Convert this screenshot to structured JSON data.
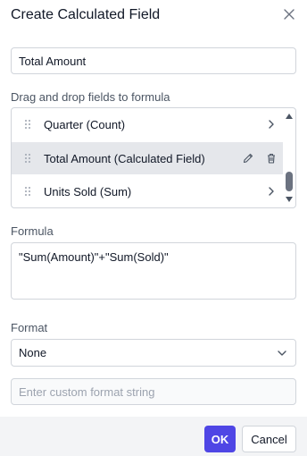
{
  "dialog": {
    "title": "Create Calculated Field",
    "close_icon": "close-icon"
  },
  "name_field": {
    "value": "Total Amount"
  },
  "fields_section": {
    "label": "Drag and drop fields to formula",
    "items": [
      {
        "label": "Quarter (Count)",
        "action_icon": "chevron-right-icon"
      },
      {
        "label": "Total Amount (Calculated Field)",
        "action_icons": [
          "edit-icon",
          "delete-icon"
        ],
        "selected": true
      },
      {
        "label": "Units Sold (Sum)",
        "action_icon": "chevron-right-icon"
      }
    ]
  },
  "formula_section": {
    "label": "Formula",
    "value": "\"Sum(Amount)\"+\"Sum(Sold)\""
  },
  "format_section": {
    "label": "Format",
    "selected": "None",
    "custom_placeholder": "Enter custom format string"
  },
  "footer": {
    "ok_label": "OK",
    "cancel_label": "Cancel"
  },
  "colors": {
    "accent": "#4f46e5",
    "selected_row": "#e5e7eb",
    "footer_bg": "#f3f4f6"
  }
}
